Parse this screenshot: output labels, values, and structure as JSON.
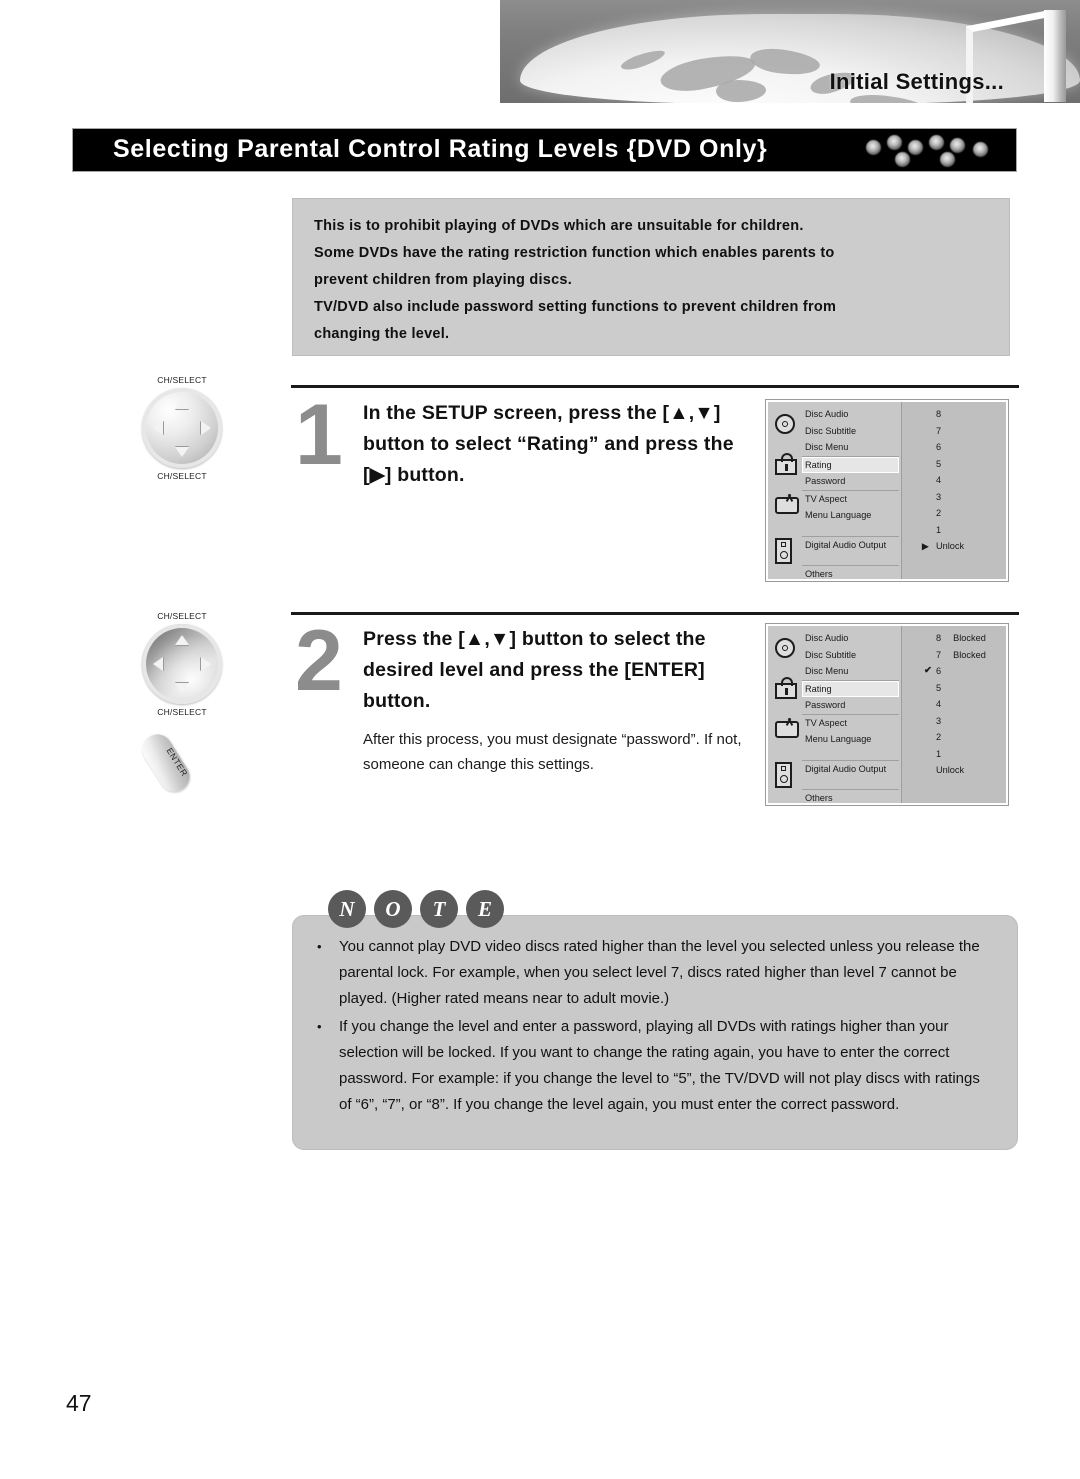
{
  "banner": {
    "title": "Initial Settings..."
  },
  "section": {
    "title": "Selecting Parental Control Rating Levels {DVD Only}"
  },
  "intro": {
    "lines": [
      "This is to prohibit playing of DVDs which are unsuitable for children.",
      "Some DVDs have the rating restriction function  which enables parents to",
      "prevent children from playing discs.",
      "TV/DVD also include password setting functions to prevent children from",
      "changing the level."
    ]
  },
  "steps": [
    {
      "number": "1",
      "heading": "In the SETUP screen, press the [▲,▼] button to select “Rating” and press the [▶] button.",
      "subtext": ""
    },
    {
      "number": "2",
      "heading": "Press the [▲,▼] button to select the desired level and press the [ENTER] button.",
      "subtext": "After this process, you must designate “password”. If not, someone can change this settings."
    }
  ],
  "remotes": [
    {
      "label_top": "CH/SELECT",
      "label_bottom": "CH/SELECT",
      "enter_label": ""
    },
    {
      "label_top": "CH/SELECT",
      "label_bottom": "CH/SELECT",
      "enter_label": "ENTER"
    }
  ],
  "osd_screens": [
    {
      "menu_items": [
        "Disc Audio",
        "Disc Subtitle",
        "Disc Menu",
        "Rating",
        "Password",
        "TV Aspect",
        "Menu Language",
        "Digital Audio Output",
        "Others"
      ],
      "selected_item": "Rating",
      "values": [
        {
          "level": "8",
          "status": "",
          "mark": ""
        },
        {
          "level": "7",
          "status": "",
          "mark": ""
        },
        {
          "level": "6",
          "status": "",
          "mark": ""
        },
        {
          "level": "5",
          "status": "",
          "mark": ""
        },
        {
          "level": "4",
          "status": "",
          "mark": ""
        },
        {
          "level": "3",
          "status": "",
          "mark": ""
        },
        {
          "level": "2",
          "status": "",
          "mark": ""
        },
        {
          "level": "1",
          "status": "",
          "mark": ""
        },
        {
          "level": "Unlock",
          "status": "",
          "mark": "▶"
        }
      ]
    },
    {
      "menu_items": [
        "Disc Audio",
        "Disc Subtitle",
        "Disc Menu",
        "Rating",
        "Password",
        "TV Aspect",
        "Menu Language",
        "Digital Audio Output",
        "Others"
      ],
      "selected_item": "Rating",
      "values": [
        {
          "level": "8",
          "status": "Blocked",
          "mark": ""
        },
        {
          "level": "7",
          "status": "Blocked",
          "mark": ""
        },
        {
          "level": "6",
          "status": "",
          "mark": "✔"
        },
        {
          "level": "5",
          "status": "",
          "mark": ""
        },
        {
          "level": "4",
          "status": "",
          "mark": ""
        },
        {
          "level": "3",
          "status": "",
          "mark": ""
        },
        {
          "level": "2",
          "status": "",
          "mark": ""
        },
        {
          "level": "1",
          "status": "",
          "mark": ""
        },
        {
          "level": "Unlock",
          "status": "",
          "mark": ""
        }
      ]
    }
  ],
  "note": {
    "letters": [
      "N",
      "O",
      "T",
      "E"
    ],
    "bullet": "•",
    "items": [
      "You cannot play DVD video discs rated higher than the level you selected unless you release the parental lock. For example, when you select level 7, discs rated higher than level 7 cannot be played. (Higher rated means near to adult movie.)",
      "If you change the level and enter a password, playing all DVDs with ratings higher than your selection will be locked. If you want to change the rating again, you have to enter the correct password. For example: if you change the level to “5”, the TV/DVD will not play discs with ratings of “6”, “7”, or “8”. If you change the level again, you  must enter the correct password."
    ]
  },
  "page_number": "47",
  "colors": {
    "title_bar_bg": "#000000",
    "intro_bg": "#cccccc",
    "note_bg": "#c9c9c9",
    "step_number": "#8c8c8c",
    "osd_bg": "#b6b6b6"
  }
}
